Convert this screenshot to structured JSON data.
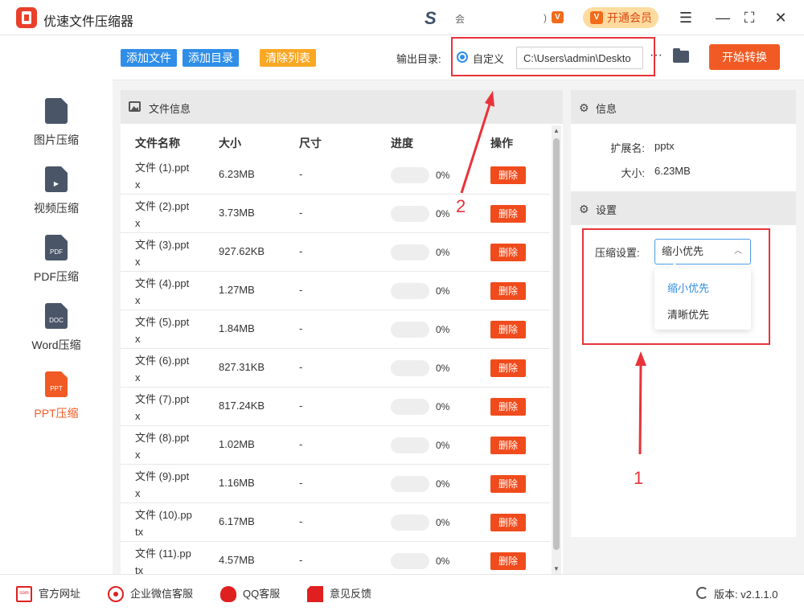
{
  "app": {
    "title": "优速文件压缩器",
    "small_text_1": "会",
    "small_text_2": ")",
    "vip_label": "开通会员",
    "vip_icon": "V",
    "s_logo": "S"
  },
  "window_controls": {
    "menu": "☰",
    "minimize": "—",
    "maximize": "⛶",
    "close": "✕"
  },
  "sidebar": {
    "items": [
      {
        "label": "图片压缩",
        "icon": "image-file-icon",
        "icon_text": ""
      },
      {
        "label": "视频压缩",
        "icon": "video-file-icon",
        "icon_text": "▶"
      },
      {
        "label": "PDF压缩",
        "icon": "pdf-file-icon",
        "icon_text": "PDF"
      },
      {
        "label": "Word压缩",
        "icon": "doc-file-icon",
        "icon_text": "DOC"
      },
      {
        "label": "PPT压缩",
        "icon": "ppt-file-icon",
        "icon_text": "PPT",
        "active": true
      }
    ]
  },
  "toolbar": {
    "add_file": "添加文件",
    "add_dir": "添加目录",
    "clear_list": "清除列表",
    "output_label": "输出目录:",
    "custom_label": "自定义",
    "output_path": "C:\\Users\\admin\\Deskto",
    "more": "···",
    "start": "开始转换"
  },
  "file_panel": {
    "title": "文件信息",
    "columns": {
      "name": "文件名称",
      "size": "大小",
      "dimension": "尺寸",
      "progress": "进度",
      "action": "操作"
    },
    "rows": [
      {
        "name": "文件 (1).pptx",
        "size": "6.23MB",
        "dim": "-",
        "progress": 0,
        "pct": "0%",
        "action": "删除"
      },
      {
        "name": "文件 (2).pptx",
        "size": "3.73MB",
        "dim": "-",
        "progress": 0,
        "pct": "0%",
        "action": "删除"
      },
      {
        "name": "文件 (3).pptx",
        "size": "927.62KB",
        "dim": "-",
        "progress": 0,
        "pct": "0%",
        "action": "删除"
      },
      {
        "name": "文件 (4).pptx",
        "size": "1.27MB",
        "dim": "-",
        "progress": 0,
        "pct": "0%",
        "action": "删除"
      },
      {
        "name": "文件 (5).pptx",
        "size": "1.84MB",
        "dim": "-",
        "progress": 0,
        "pct": "0%",
        "action": "删除"
      },
      {
        "name": "文件 (6).pptx",
        "size": "827.31KB",
        "dim": "-",
        "progress": 0,
        "pct": "0%",
        "action": "删除"
      },
      {
        "name": "文件 (7).pptx",
        "size": "817.24KB",
        "dim": "-",
        "progress": 0,
        "pct": "0%",
        "action": "删除"
      },
      {
        "name": "文件 (8).pptx",
        "size": "1.02MB",
        "dim": "-",
        "progress": 0,
        "pct": "0%",
        "action": "删除"
      },
      {
        "name": "文件 (9).pptx",
        "size": "1.16MB",
        "dim": "-",
        "progress": 0,
        "pct": "0%",
        "action": "删除"
      },
      {
        "name": "文件 (10).pptx",
        "size": "6.17MB",
        "dim": "-",
        "progress": 0,
        "pct": "0%",
        "action": "删除"
      },
      {
        "name": "文件 (11).pptx",
        "size": "4.57MB",
        "dim": "-",
        "progress": 0,
        "pct": "0%",
        "action": "删除"
      }
    ]
  },
  "info_panel": {
    "info_title": "信息",
    "ext_key": "扩展名:",
    "ext_val": "pptx",
    "size_key": "大小:",
    "size_val": "6.23MB",
    "settings_title": "设置",
    "compress_label": "压缩设置:",
    "compress_selected": "缩小优先",
    "compress_options": [
      "缩小优先",
      "清晰优先"
    ]
  },
  "annotations": {
    "num1": "1",
    "num2": "2"
  },
  "footer": {
    "website": "官方网址",
    "website_icon_text": "com",
    "wechat": "企业微信客服",
    "qq": "QQ客服",
    "feedback": "意见反馈",
    "version": "版本: v2.1.1.0"
  },
  "colors": {
    "accent": "#f15a24",
    "blue": "#2f8ee8",
    "annotation_red": "#e8333a"
  }
}
